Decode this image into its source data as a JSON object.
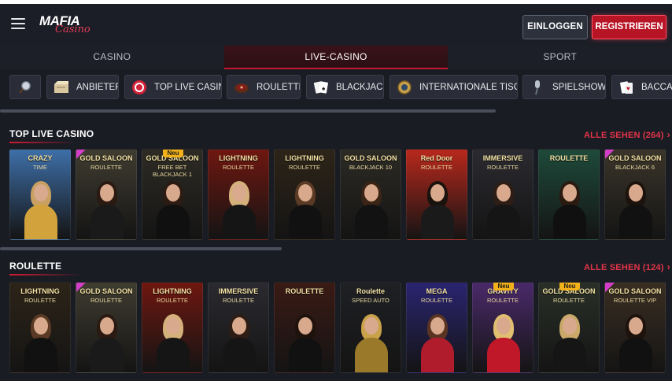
{
  "header": {
    "logo_top": "MAFIA",
    "logo_script": "Casino",
    "login_label": "EINLOGGEN",
    "register_label": "REGISTRIEREN"
  },
  "tabs": [
    {
      "label": "CASINO",
      "active": false
    },
    {
      "label": "LIVE-CASINO",
      "active": true
    },
    {
      "label": "SPORT",
      "active": false
    }
  ],
  "categories": [
    {
      "label": "",
      "icon": "magnifier-icon"
    },
    {
      "label": "ANBIETER",
      "icon": "box-icon"
    },
    {
      "label": "TOP LIVE CASINO",
      "icon": "chip-icon"
    },
    {
      "label": "ROULETTE",
      "icon": "roulette-wheel-icon"
    },
    {
      "label": "BLACKJACK",
      "icon": "cards-icon"
    },
    {
      "label": "INTERNATIONALE TISCHE",
      "icon": "globe-icon"
    },
    {
      "label": "SPIELSHOWS",
      "icon": "microphone-icon"
    },
    {
      "label": "BACCARAT",
      "icon": "playing-cards-icon"
    }
  ],
  "sections": [
    {
      "title": "TOP LIVE CASINO",
      "see_all": "ALLE SEHEN (264)",
      "tiles": [
        {
          "line1": "CRAZY",
          "line2": "TIME",
          "badge": "",
          "bg": "#3e6fa8",
          "hair": "#c7a062",
          "body": "#d2a23c"
        },
        {
          "line1": "GOLD SALOON",
          "line2": "ROULETTE",
          "badge": "new",
          "bg": "#3f3c30",
          "hair": "#2a1a12",
          "body": "#1a1a1a"
        },
        {
          "line1": "GOLD SALOON",
          "line2": "FREE BET BLACKJACK 1",
          "badge": "Neu",
          "bg": "#2e2b24",
          "hair": "#2b1b12",
          "body": "#101010"
        },
        {
          "line1": "LIGHTNING",
          "line2": "ROULETTE",
          "badge": "",
          "bg": "#6e1710",
          "hair": "#d4b07a",
          "body": "#151515"
        },
        {
          "line1": "LIGHTNING",
          "line2": "ROULETTE",
          "badge": "",
          "bg": "#2d2418",
          "hair": "#5a3a24",
          "body": "#111111"
        },
        {
          "line1": "GOLD SALOON",
          "line2": "BLACKJACK 10",
          "badge": "",
          "bg": "#2c2a24",
          "hair": "#3a2416",
          "body": "#121212"
        },
        {
          "line1": "Red Door",
          "line2": "ROULETTE",
          "badge": "",
          "bg": "#b8281c",
          "hair": "#1a120c",
          "body": "#1a1a1a"
        },
        {
          "line1": "IMMERSIVE",
          "line2": "ROULETTE",
          "badge": "",
          "bg": "#2b2a30",
          "hair": "#2e1d14",
          "body": "#151515"
        },
        {
          "line1": "ROULETTE",
          "line2": "",
          "badge": "",
          "bg": "#1e4a3a",
          "hair": "#2a1a10",
          "body": "#101010"
        },
        {
          "line1": "GOLD SALOON",
          "line2": "BLACKJACK 6",
          "badge": "new",
          "bg": "#3a352a",
          "hair": "#1d130c",
          "body": "#111111"
        }
      ]
    },
    {
      "title": "ROULETTE",
      "see_all": "ALLE SEHEN (124)",
      "tiles": [
        {
          "line1": "LIGHTNING",
          "line2": "ROULETTE",
          "badge": "",
          "bg": "#2d2418",
          "hair": "#5a3a24",
          "body": "#111111"
        },
        {
          "line1": "GOLD SALOON",
          "line2": "ROULETTE",
          "badge": "new",
          "bg": "#3f3c30",
          "hair": "#2a1a12",
          "body": "#1a1a1a"
        },
        {
          "line1": "LIGHTNING",
          "line2": "ROULETTE",
          "badge": "",
          "bg": "#6e1710",
          "hair": "#d4b07a",
          "body": "#151515"
        },
        {
          "line1": "IMMERSIVE",
          "line2": "ROULETTE",
          "badge": "",
          "bg": "#2b2a30",
          "hair": "#2e1d14",
          "body": "#151515"
        },
        {
          "line1": "ROULETTE",
          "line2": "",
          "badge": "",
          "bg": "#3a1a14",
          "hair": "#1e130c",
          "body": "#111111"
        },
        {
          "line1": "Roulette",
          "line2": "SPEED AUTO",
          "badge": "",
          "bg": "#1f2024",
          "hair": "#c9a24a",
          "body": "#9a7a2a"
        },
        {
          "line1": "MEGA",
          "line2": "ROULETTE",
          "badge": "",
          "bg": "#2a2470",
          "hair": "#5a3422",
          "body": "#b01c2c"
        },
        {
          "line1": "GRAVITY",
          "line2": "ROULETTE",
          "badge": "Neu",
          "bg": "#4a2a6a",
          "hair": "#e0c070",
          "body": "#c01828"
        },
        {
          "line1": "GOLD SALOON",
          "line2": "ROULETTE",
          "badge": "Neu",
          "bg": "#2a3028",
          "hair": "#c9a86a",
          "body": "#151515"
        },
        {
          "line1": "GOLD SALOON",
          "line2": "ROULETTE VIP",
          "badge": "new",
          "bg": "#3a2e22",
          "hair": "#1d130c",
          "body": "#111111"
        }
      ]
    }
  ],
  "colors": {
    "accent": "#d11c32",
    "background": "#1a1c24",
    "badge": "#f2b11b"
  }
}
